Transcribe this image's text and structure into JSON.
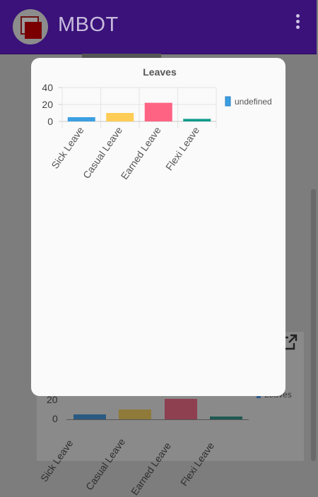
{
  "app": {
    "title": "MBOT"
  },
  "icons": {
    "menu": "kebab-menu-icon",
    "logo": "app-logo",
    "open_external": "open-external-icon"
  },
  "colors": {
    "app_bar": "#3a1279",
    "overlay": "#7d7d7d",
    "modal_bg": "#fafafa"
  },
  "background_chart": {
    "legend": "Leaves",
    "ticks": [
      "20",
      "0"
    ],
    "categories": [
      "Sick Leave",
      "Casual Leave",
      "Earned Leave",
      "Flexi Leave"
    ]
  },
  "modal": {
    "chart_data": {
      "type": "bar",
      "title": "Leaves",
      "categories": [
        "Sick Leave",
        "Casual Leave",
        "Earned Leave",
        "Flexi Leave"
      ],
      "series": [
        {
          "name": "undefined",
          "values": [
            5,
            10,
            22,
            3
          ]
        }
      ],
      "bar_colors": [
        "#3b9fe2",
        "#ffcd56",
        "#ff6384",
        "#0f9b8c"
      ],
      "y_ticks": [
        "40",
        "20",
        "0"
      ],
      "ylim": [
        0,
        40
      ],
      "grid": true,
      "legend_position": "right"
    }
  }
}
